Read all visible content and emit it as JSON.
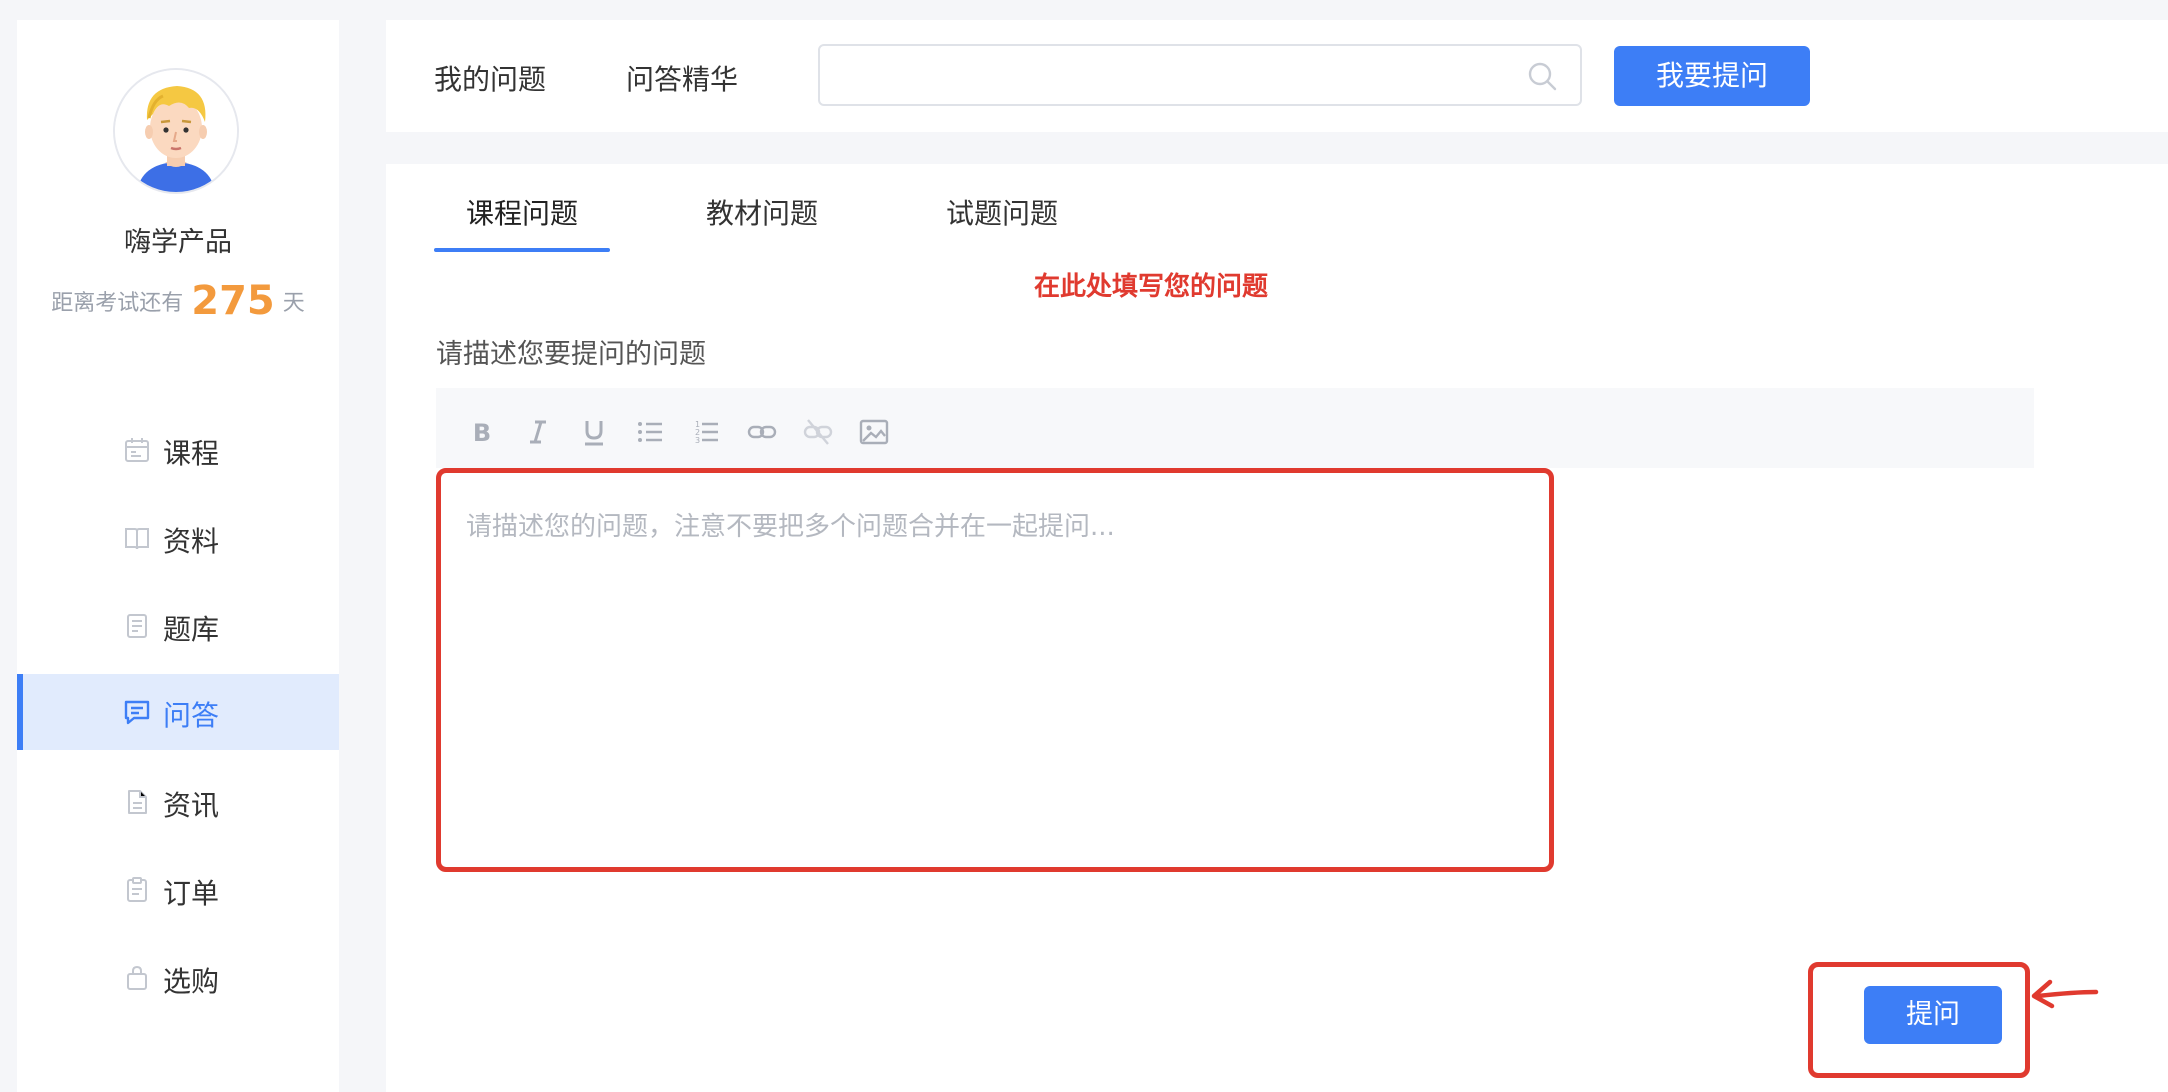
{
  "sidebar": {
    "username": "嗨学产品",
    "countdown": {
      "prefix": "距离考试还有",
      "days": "275",
      "suffix": "天"
    },
    "items": [
      {
        "label": "课程",
        "icon": "calendar-icon",
        "active": false
      },
      {
        "label": "资料",
        "icon": "book-icon",
        "active": false
      },
      {
        "label": "题库",
        "icon": "document-icon",
        "active": false
      },
      {
        "label": "问答",
        "icon": "chat-icon",
        "active": true
      },
      {
        "label": "资讯",
        "icon": "file-icon",
        "active": false
      },
      {
        "label": "订单",
        "icon": "receipt-icon",
        "active": false
      },
      {
        "label": "选购",
        "icon": "bag-icon",
        "active": false
      }
    ]
  },
  "topbar": {
    "links": [
      "我的问题",
      "问答精华"
    ],
    "search": {
      "value": "",
      "placeholder": ""
    },
    "ask_button": "我要提问"
  },
  "main": {
    "tabs": [
      {
        "label": "课程问题",
        "active": true
      },
      {
        "label": "教材问题",
        "active": false
      },
      {
        "label": "试题问题",
        "active": false
      }
    ],
    "form_label": "请描述您要提问的问题",
    "editor": {
      "toolbar": [
        "bold-icon",
        "italic-icon",
        "underline-icon",
        "bullet-list-icon",
        "numbered-list-icon",
        "link-icon",
        "unlink-icon",
        "image-icon"
      ],
      "placeholder": "请描述您的问题，注意不要把多个问题合并在一起提问..."
    },
    "submit_button": "提问"
  },
  "annotations": {
    "editor_hint": "在此处填写您的问题"
  },
  "colors": {
    "accent": "#3d7ef6",
    "annotation": "#e03a2f",
    "countdown": "#f39a3d",
    "active_nav_bg": "#e1ebfd"
  }
}
